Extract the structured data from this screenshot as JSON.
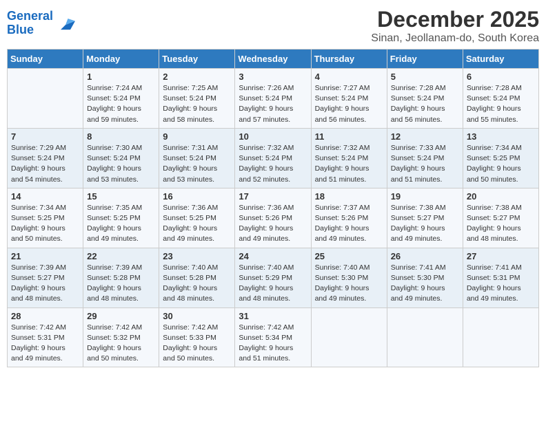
{
  "header": {
    "logo_line1": "General",
    "logo_line2": "Blue",
    "month": "December 2025",
    "location": "Sinan, Jeollanam-do, South Korea"
  },
  "days_of_week": [
    "Sunday",
    "Monday",
    "Tuesday",
    "Wednesday",
    "Thursday",
    "Friday",
    "Saturday"
  ],
  "weeks": [
    [
      {
        "day": "",
        "text": ""
      },
      {
        "day": "1",
        "text": "Sunrise: 7:24 AM\nSunset: 5:24 PM\nDaylight: 9 hours\nand 59 minutes."
      },
      {
        "day": "2",
        "text": "Sunrise: 7:25 AM\nSunset: 5:24 PM\nDaylight: 9 hours\nand 58 minutes."
      },
      {
        "day": "3",
        "text": "Sunrise: 7:26 AM\nSunset: 5:24 PM\nDaylight: 9 hours\nand 57 minutes."
      },
      {
        "day": "4",
        "text": "Sunrise: 7:27 AM\nSunset: 5:24 PM\nDaylight: 9 hours\nand 56 minutes."
      },
      {
        "day": "5",
        "text": "Sunrise: 7:28 AM\nSunset: 5:24 PM\nDaylight: 9 hours\nand 56 minutes."
      },
      {
        "day": "6",
        "text": "Sunrise: 7:28 AM\nSunset: 5:24 PM\nDaylight: 9 hours\nand 55 minutes."
      }
    ],
    [
      {
        "day": "7",
        "text": "Sunrise: 7:29 AM\nSunset: 5:24 PM\nDaylight: 9 hours\nand 54 minutes."
      },
      {
        "day": "8",
        "text": "Sunrise: 7:30 AM\nSunset: 5:24 PM\nDaylight: 9 hours\nand 53 minutes."
      },
      {
        "day": "9",
        "text": "Sunrise: 7:31 AM\nSunset: 5:24 PM\nDaylight: 9 hours\nand 53 minutes."
      },
      {
        "day": "10",
        "text": "Sunrise: 7:32 AM\nSunset: 5:24 PM\nDaylight: 9 hours\nand 52 minutes."
      },
      {
        "day": "11",
        "text": "Sunrise: 7:32 AM\nSunset: 5:24 PM\nDaylight: 9 hours\nand 51 minutes."
      },
      {
        "day": "12",
        "text": "Sunrise: 7:33 AM\nSunset: 5:24 PM\nDaylight: 9 hours\nand 51 minutes."
      },
      {
        "day": "13",
        "text": "Sunrise: 7:34 AM\nSunset: 5:25 PM\nDaylight: 9 hours\nand 50 minutes."
      }
    ],
    [
      {
        "day": "14",
        "text": "Sunrise: 7:34 AM\nSunset: 5:25 PM\nDaylight: 9 hours\nand 50 minutes."
      },
      {
        "day": "15",
        "text": "Sunrise: 7:35 AM\nSunset: 5:25 PM\nDaylight: 9 hours\nand 49 minutes."
      },
      {
        "day": "16",
        "text": "Sunrise: 7:36 AM\nSunset: 5:25 PM\nDaylight: 9 hours\nand 49 minutes."
      },
      {
        "day": "17",
        "text": "Sunrise: 7:36 AM\nSunset: 5:26 PM\nDaylight: 9 hours\nand 49 minutes."
      },
      {
        "day": "18",
        "text": "Sunrise: 7:37 AM\nSunset: 5:26 PM\nDaylight: 9 hours\nand 49 minutes."
      },
      {
        "day": "19",
        "text": "Sunrise: 7:38 AM\nSunset: 5:27 PM\nDaylight: 9 hours\nand 49 minutes."
      },
      {
        "day": "20",
        "text": "Sunrise: 7:38 AM\nSunset: 5:27 PM\nDaylight: 9 hours\nand 48 minutes."
      }
    ],
    [
      {
        "day": "21",
        "text": "Sunrise: 7:39 AM\nSunset: 5:27 PM\nDaylight: 9 hours\nand 48 minutes."
      },
      {
        "day": "22",
        "text": "Sunrise: 7:39 AM\nSunset: 5:28 PM\nDaylight: 9 hours\nand 48 minutes."
      },
      {
        "day": "23",
        "text": "Sunrise: 7:40 AM\nSunset: 5:28 PM\nDaylight: 9 hours\nand 48 minutes."
      },
      {
        "day": "24",
        "text": "Sunrise: 7:40 AM\nSunset: 5:29 PM\nDaylight: 9 hours\nand 48 minutes."
      },
      {
        "day": "25",
        "text": "Sunrise: 7:40 AM\nSunset: 5:30 PM\nDaylight: 9 hours\nand 49 minutes."
      },
      {
        "day": "26",
        "text": "Sunrise: 7:41 AM\nSunset: 5:30 PM\nDaylight: 9 hours\nand 49 minutes."
      },
      {
        "day": "27",
        "text": "Sunrise: 7:41 AM\nSunset: 5:31 PM\nDaylight: 9 hours\nand 49 minutes."
      }
    ],
    [
      {
        "day": "28",
        "text": "Sunrise: 7:42 AM\nSunset: 5:31 PM\nDaylight: 9 hours\nand 49 minutes."
      },
      {
        "day": "29",
        "text": "Sunrise: 7:42 AM\nSunset: 5:32 PM\nDaylight: 9 hours\nand 50 minutes."
      },
      {
        "day": "30",
        "text": "Sunrise: 7:42 AM\nSunset: 5:33 PM\nDaylight: 9 hours\nand 50 minutes."
      },
      {
        "day": "31",
        "text": "Sunrise: 7:42 AM\nSunset: 5:34 PM\nDaylight: 9 hours\nand 51 minutes."
      },
      {
        "day": "",
        "text": ""
      },
      {
        "day": "",
        "text": ""
      },
      {
        "day": "",
        "text": ""
      }
    ]
  ]
}
